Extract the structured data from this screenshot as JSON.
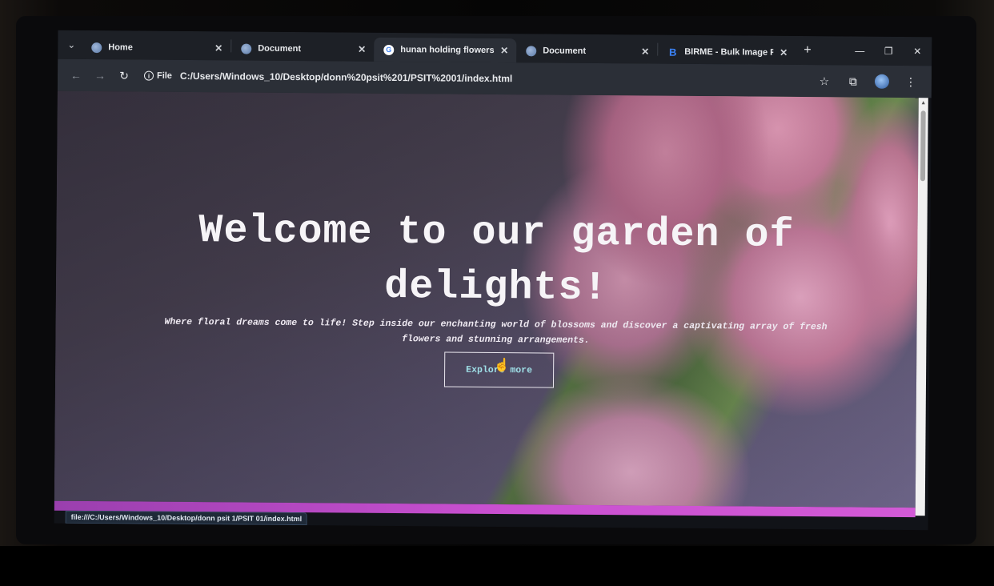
{
  "browser": {
    "tabs": [
      {
        "title": "Home",
        "favicon": "globe-icon",
        "active": false
      },
      {
        "title": "Document",
        "favicon": "globe-icon",
        "active": false
      },
      {
        "title": "hunan holding flowers pink",
        "favicon": "google-icon",
        "active": true
      },
      {
        "title": "Document",
        "favicon": "globe-icon",
        "active": false
      },
      {
        "title": "BIRME - Bulk Image Resizing",
        "favicon": "birme-icon",
        "active": false
      }
    ],
    "birme_letter": "B",
    "google_letter": "G",
    "toolbar": {
      "site_info_label": "File",
      "url": "C:/Users/Windows_10/Desktop/donn%20psit%201/PSIT%2001/index.html"
    },
    "status_url": "file:///C:/Users/Windows_10/Desktop/donn psit 1/PSIT 01/index.html"
  },
  "hero": {
    "title": "Welcome to our garden of delights!",
    "subtitle": "Where floral dreams come to life! Step inside our enchanting world of blossoms and discover a captivating array of fresh flowers and stunning arrangements.",
    "button_label": "Explore more"
  },
  "colors": {
    "accent_magenta": "#c84fd0",
    "button_text": "#9fe0e8",
    "chrome_bg": "#2b2f37"
  }
}
